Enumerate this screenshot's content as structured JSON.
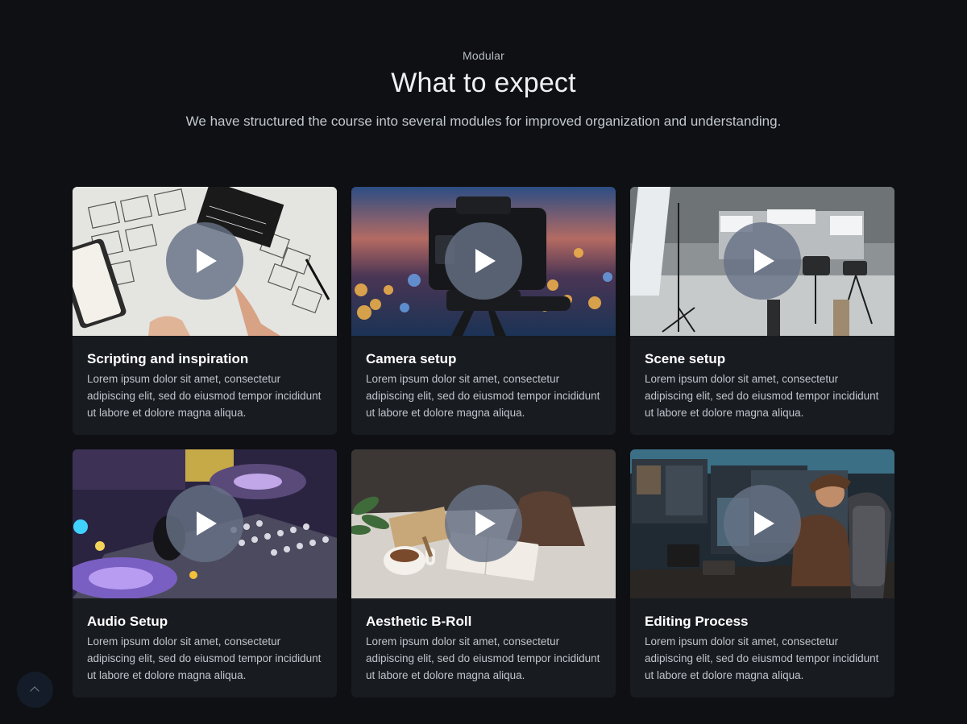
{
  "section": {
    "eyebrow": "Modular",
    "title": "What to expect",
    "subtitle": "We have structured the course into several modules for improved organization and understanding."
  },
  "modules": [
    {
      "title": "Scripting and inspiration",
      "description": "Lorem ipsum dolor sit amet, consectetur adipiscing elit, sed do eiusmod tempor incididunt ut labore et dolore magna aliqua.",
      "image": "storyboard sketches with clapperboard"
    },
    {
      "title": "Camera setup",
      "description": "Lorem ipsum dolor sit amet, consectetur adipiscing elit, sed do eiusmod tempor incididunt ut labore et dolore magna aliqua.",
      "image": "camera on tripod with bokeh city lights"
    },
    {
      "title": "Scene setup",
      "description": "Lorem ipsum dolor sit amet, consectetur adipiscing elit, sed do eiusmod tempor incididunt ut labore et dolore magna aliqua.",
      "image": "film studio with lights and cameras"
    },
    {
      "title": "Audio Setup",
      "description": "Lorem ipsum dolor sit amet, consectetur adipiscing elit, sed do eiusmod tempor incididunt ut labore et dolore magna aliqua.",
      "image": "dj mixer console"
    },
    {
      "title": "Aesthetic B-Roll",
      "description": "Lorem ipsum dolor sit amet, consectetur adipiscing elit, sed do eiusmod tempor incididunt ut labore et dolore magna aliqua.",
      "image": "desk with coffee cup and notebook"
    },
    {
      "title": "Editing Process",
      "description": "Lorem ipsum dolor sit amet, consectetur adipiscing elit, sed do eiusmod tempor incididunt ut labore et dolore magna aliqua.",
      "image": "editor at multi-monitor workstation"
    }
  ],
  "icons": {
    "play": "play-icon",
    "scroll_top": "chevron-up-icon"
  },
  "colors": {
    "background": "#0e1013",
    "card": "#181b20",
    "play_button": "#667285"
  }
}
